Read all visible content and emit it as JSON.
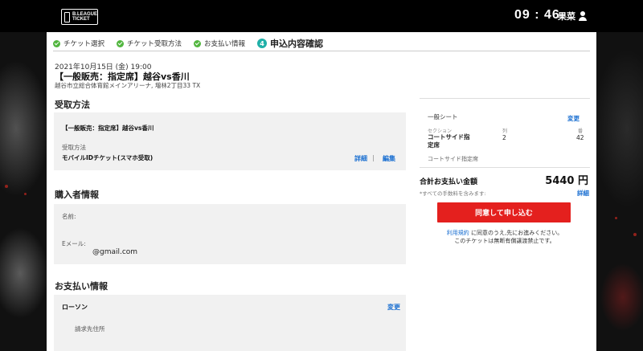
{
  "header": {
    "logo_line1": "B.LEAGUE",
    "logo_line2": "TICKET",
    "clock": "09 : 46",
    "user_name": "果菜"
  },
  "steps": [
    {
      "label": "チケット選択",
      "state": "done"
    },
    {
      "label": "チケット受取方法",
      "state": "done"
    },
    {
      "label": "お支払い情報",
      "state": "done"
    },
    {
      "number": "4",
      "label": "申込内容確認",
      "state": "current"
    }
  ],
  "event": {
    "date": "2021年10月15日 (金) 19:00",
    "title": "【一般販売：指定席】越谷vs香川",
    "venue": "越谷市立総合体育館メインアリーナ, 増林2丁目33 TX"
  },
  "receive": {
    "heading": "受取方法",
    "ticket_name": "【一般販売：指定席】越谷vs香川",
    "method_label": "受取方法",
    "method_value": "モバイルIDチケット(スマホ受取)",
    "detail_link": "詳細",
    "separator": "|",
    "edit_link": "編集"
  },
  "buyer": {
    "heading": "購入者情報",
    "name_label": "名前:",
    "email_label": "Eメール:",
    "email_value": "@gmail.com"
  },
  "payment": {
    "heading": "お支払い情報",
    "method": "ローソン",
    "change_link": "変更",
    "billing_label": "請求先住所"
  },
  "summary": {
    "seat_type": "一般シート",
    "change_link": "変更",
    "section_label": "セクション",
    "row_label": "列",
    "number_label": "番",
    "section_value_line1": "コートサイド指",
    "section_value_line2": "定席",
    "row_value": "2",
    "number_value": "42",
    "section_caption": "コートサイド指定席",
    "total_label": "合計お支払い金額",
    "total_value": "5440 円",
    "fee_note": "*すべての手数料を含みます:",
    "detail_link": "詳細",
    "order_button": "同意して申し込む",
    "terms_link": "利用規約",
    "terms_text": "に同意のうえ,先にお進みください。",
    "notice": "このチケットは無断有償譲渡禁止です。"
  },
  "colors": {
    "accent_red": "#e4201e",
    "link_blue": "#1a6fd1",
    "step_done_green": "#52b63f",
    "step_current_teal": "#20b0a8"
  }
}
